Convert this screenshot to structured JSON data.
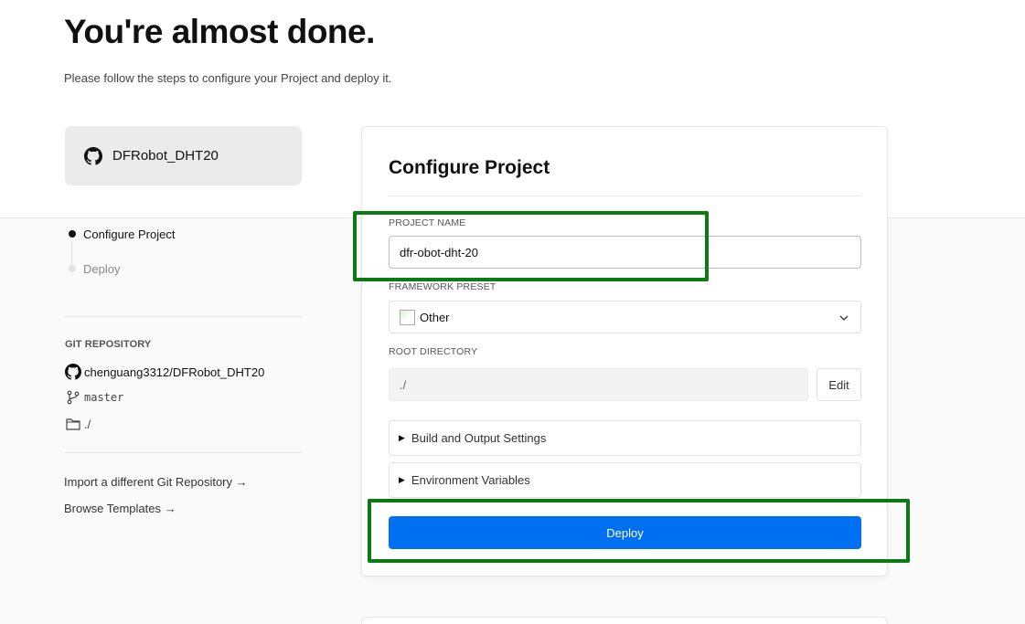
{
  "header": {
    "title": "You're almost done.",
    "subtitle": "Please follow the steps to configure your Project and deploy it."
  },
  "repo_card": {
    "name": "DFRobot_DHT20",
    "icon": "github-icon"
  },
  "steps": [
    {
      "label": "Configure Project",
      "state": "active"
    },
    {
      "label": "Deploy",
      "state": "inactive"
    }
  ],
  "git": {
    "section_label": "GIT REPOSITORY",
    "repository": "chenguang3312/DFRobot_DHT20",
    "branch": "master",
    "directory": "./"
  },
  "links": {
    "import": "Import a different Git Repository →",
    "templates": "Browse Templates →"
  },
  "configure": {
    "title": "Configure Project",
    "project_name_label": "PROJECT NAME",
    "project_name_value": "dfr-obot-dht-20",
    "framework_label": "FRAMEWORK PRESET",
    "framework_value": "Other",
    "root_label": "ROOT DIRECTORY",
    "root_value": "./",
    "edit_label": "Edit",
    "build_settings_label": "Build and Output Settings",
    "env_vars_label": "Environment Variables",
    "deploy_label": "Deploy"
  },
  "colors": {
    "accent": "#0070f3",
    "highlight": "#0a7a12",
    "background": "#fafafa"
  }
}
